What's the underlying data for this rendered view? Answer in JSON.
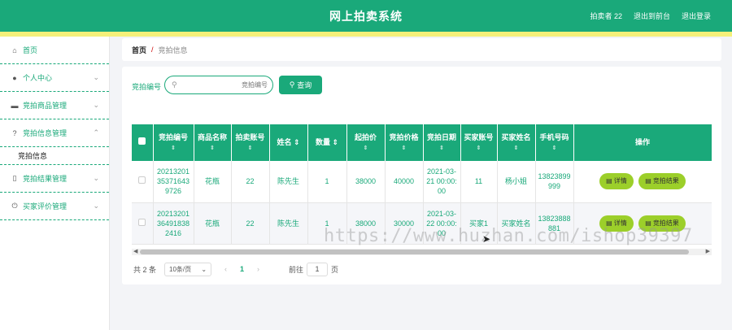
{
  "header": {
    "title": "网上拍卖系统",
    "user": "拍卖者 22",
    "back_to_front": "退出到前台",
    "logout": "退出登录"
  },
  "sidebar": {
    "items": [
      {
        "label": "首页",
        "icon": "home-icon"
      },
      {
        "label": "个人中心",
        "icon": "user-icon"
      },
      {
        "label": "竞拍商品管理",
        "icon": "briefcase-icon"
      },
      {
        "label": "竞拍信息管理",
        "icon": "help-circle-icon"
      },
      {
        "label": "竞拍结果管理",
        "icon": "phone-icon"
      },
      {
        "label": "买家评价管理",
        "icon": "power-icon"
      }
    ],
    "submenu_item": "竞拍信息"
  },
  "breadcrumb": {
    "home": "首页",
    "separator": "/",
    "current": "竞拍信息"
  },
  "search": {
    "label": "竞拍编号",
    "placeholder": "竞拍编号",
    "button": "查询"
  },
  "table": {
    "headers": [
      "竞拍编号",
      "商品名称",
      "拍卖账号",
      "姓名",
      "数量",
      "起拍价",
      "竞拍价格",
      "竞拍日期",
      "买家账号",
      "买家姓名",
      "手机号码",
      "操作"
    ],
    "rows": [
      {
        "id": "20213201353716439726",
        "product": "花瓶",
        "seller": "22",
        "name": "陈先生",
        "qty": "1",
        "start": "38000",
        "bid": "40000",
        "date": "2021-03-21 00:00:00",
        "buyer": "11",
        "buyer_name": "杨小姐",
        "phone": "13823899999"
      },
      {
        "id": "20213201364918382416",
        "product": "花瓶",
        "seller": "22",
        "name": "陈先生",
        "qty": "1",
        "start": "38000",
        "bid": "30000",
        "date": "2021-03-22 00:00:00",
        "buyer": "买家1",
        "buyer_name": "买家姓名",
        "phone": "13823888881"
      }
    ],
    "actions": {
      "detail": "详情",
      "result": "竞拍结果"
    }
  },
  "pagination": {
    "total": "共 2 条",
    "page_size": "10条/页",
    "current_page": "1",
    "goto_label": "前往",
    "goto_value": "1",
    "goto_unit": "页"
  },
  "watermark": "https://www.huzhan.com/ishop39397",
  "colors": {
    "primary": "#1aa97a",
    "accent_yellow": "#f5f07a",
    "action_button": "#9ccf2a"
  }
}
